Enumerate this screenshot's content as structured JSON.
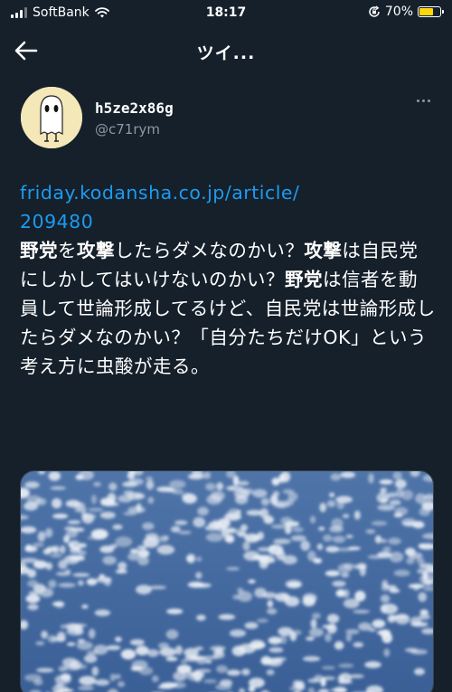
{
  "status_bar": {
    "carrier": "SoftBank",
    "time": "18:17",
    "battery": "70%",
    "battery_level": 0.7
  },
  "nav": {
    "title": "ツイ..."
  },
  "author": {
    "display_name": "h5ze2x86g",
    "handle": "@c71rym"
  },
  "tweet": {
    "link_line1": "friday.kodansha.co.jp/article/",
    "link_line2": "209480",
    "segments": [
      {
        "t": "野党",
        "bold": true
      },
      {
        "t": "を",
        "bold": false
      },
      {
        "t": "攻撃",
        "bold": true
      },
      {
        "t": "したらダメなのかい？",
        "bold": false
      },
      {
        "t": "攻撃",
        "bold": true
      },
      {
        "t": "は自民党にしかしてはいけないのかい？",
        "bold": false
      },
      {
        "t": "野党",
        "bold": true
      },
      {
        "t": "は信者を動員して世論形成してるけど、自民党は世論形成したらダメなのかい？「自分たちだけOK」という考え方に虫酸が走る。",
        "bold": false
      }
    ]
  },
  "icons": {
    "back": "arrow-left-icon",
    "more": "more-horizontal-icon",
    "wifi": "wifi-icon",
    "lock": "orientation-lock-icon"
  },
  "colors": {
    "background": "#15202b",
    "link": "#1d9bf0",
    "secondary_text": "#8b98a5",
    "battery": "#ffd60a"
  }
}
